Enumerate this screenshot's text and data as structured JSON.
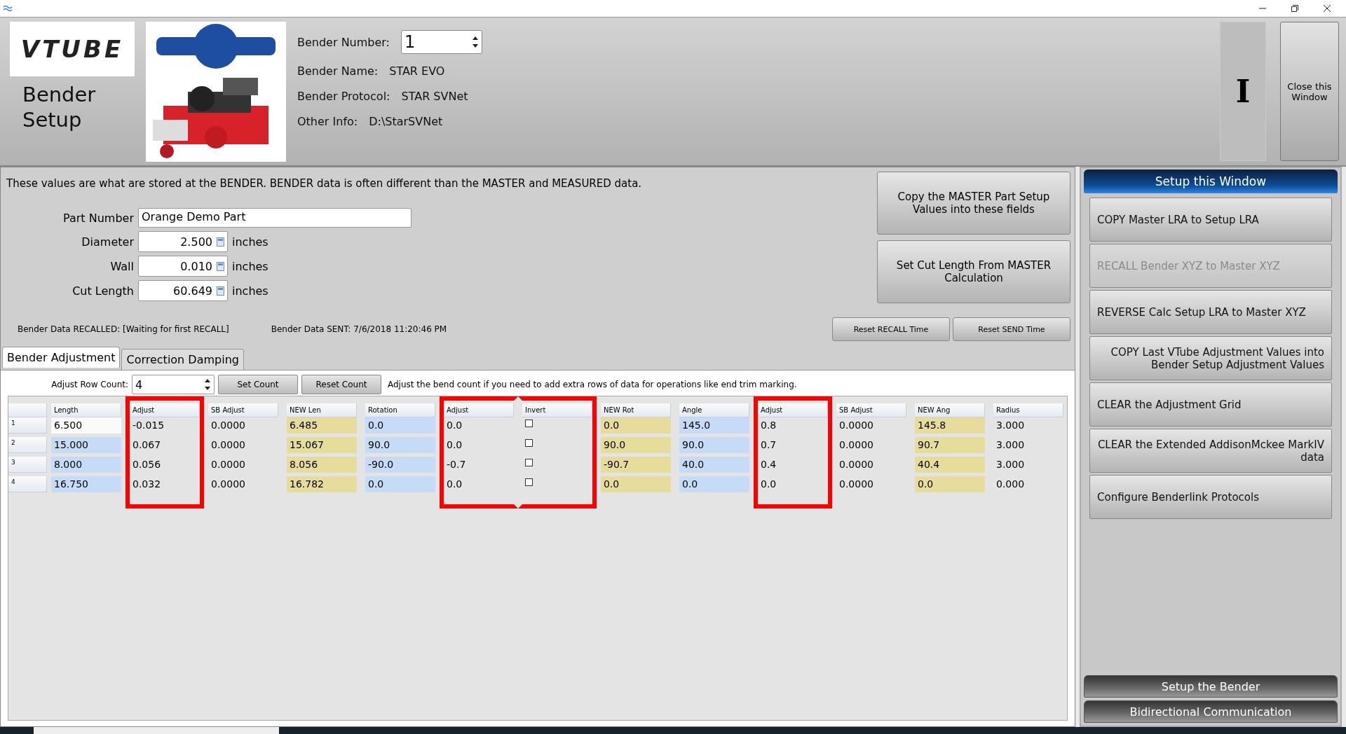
{
  "header": {
    "logo": "VTUBE",
    "title": "Bender Setup",
    "info": [
      {
        "kind": "spinner",
        "label": "Bender Number:",
        "value": "1"
      },
      {
        "kind": "text",
        "label": "Bender Name:",
        "value": "STAR EVO"
      },
      {
        "kind": "text",
        "label": "Bender Protocol:",
        "value": "STAR SVNet"
      },
      {
        "kind": "text",
        "label": "Other Info:",
        "value": "D:\\StarSVNet"
      }
    ],
    "cursor_glyph": "I",
    "close_button": "Close this Window"
  },
  "intro": "These values are what are stored at the BENDER.  BENDER data is often different than the MASTER and MEASURED data.",
  "form": [
    {
      "kind": "text",
      "label": "Part Number",
      "value": "Orange Demo Part"
    },
    {
      "kind": "number",
      "label": "Diameter",
      "value": "2.500",
      "unit": "inches"
    },
    {
      "kind": "number",
      "label": "Wall",
      "value": "0.010",
      "unit": "inches"
    },
    {
      "kind": "number",
      "label": "Cut Length",
      "value": "60.649",
      "unit": "inches"
    }
  ],
  "master_buttons": [
    "Copy the MASTER Part Setup Values into these fields",
    "Set Cut Length From MASTER Calculation"
  ],
  "status": [
    {
      "label": "Bender Data RECALLED:",
      "value": "[Waiting for first RECALL]"
    },
    {
      "label": "Bender Data SENT:",
      "value": "7/6/2018 11:20:46 PM"
    }
  ],
  "reset_buttons": [
    "Reset RECALL Time",
    "Reset SEND Time"
  ],
  "tabs": [
    {
      "label": "Bender Adjustment",
      "selected": true
    },
    {
      "label": "Correction Damping",
      "selected": false
    }
  ],
  "row_count": {
    "label": "Adjust Row Count:",
    "value": "4",
    "buttons": [
      "Set Count",
      "Reset Count"
    ],
    "hint": "Adjust the bend count if you need to add extra rows of data for operations like end trim marking."
  },
  "grid": {
    "columns": [
      {
        "label": "Length",
        "kind": "input",
        "highlighted": false
      },
      {
        "label": "Adjust",
        "kind": "plain",
        "highlighted": true
      },
      {
        "label": "SB Adjust",
        "kind": "plain",
        "highlighted": false
      },
      {
        "label": "NEW Len",
        "kind": "computed",
        "highlighted": false
      },
      {
        "label": "Rotation",
        "kind": "input",
        "highlighted": false
      },
      {
        "label": "Adjust",
        "kind": "plain",
        "highlighted": true
      },
      {
        "label": "Invert",
        "kind": "checkbox",
        "highlighted": true
      },
      {
        "label": "NEW Rot",
        "kind": "computed",
        "highlighted": false
      },
      {
        "label": "Angle",
        "kind": "input",
        "highlighted": false
      },
      {
        "label": "Adjust",
        "kind": "plain",
        "highlighted": true
      },
      {
        "label": "SB Adjust",
        "kind": "plain",
        "highlighted": false
      },
      {
        "label": "NEW Ang",
        "kind": "computed",
        "highlighted": false
      },
      {
        "label": "Radius",
        "kind": "plain",
        "highlighted": false
      }
    ],
    "rows": [
      {
        "number": "1",
        "focused": true,
        "cells": [
          "6.500",
          "-0.015",
          "0.0000",
          "6.485",
          "0.0",
          "0.0",
          false,
          "0.0",
          "145.0",
          "0.8",
          "0.0000",
          "145.8",
          "3.000"
        ]
      },
      {
        "number": "2",
        "focused": false,
        "cells": [
          "15.000",
          "0.067",
          "0.0000",
          "15.067",
          "90.0",
          "0.0",
          false,
          "90.0",
          "90.0",
          "0.7",
          "0.0000",
          "90.7",
          "3.000"
        ]
      },
      {
        "number": "3",
        "focused": false,
        "cells": [
          "8.000",
          "0.056",
          "0.0000",
          "8.056",
          "-90.0",
          "-0.7",
          false,
          "-90.7",
          "40.0",
          "0.4",
          "0.0000",
          "40.4",
          "3.000"
        ]
      },
      {
        "number": "4",
        "focused": false,
        "cells": [
          "16.750",
          "0.032",
          "0.0000",
          "16.782",
          "0.0",
          "0.0",
          false,
          "0.0",
          "0.0",
          "0.0",
          "0.0000",
          "0.0",
          "0.000"
        ]
      }
    ]
  },
  "side_panel": {
    "title": "Setup this Window",
    "buttons": [
      {
        "label": "COPY Master LRA to Setup LRA",
        "disabled": false
      },
      {
        "label": "RECALL Bender XYZ to Master XYZ",
        "disabled": true
      },
      {
        "label": "REVERSE Calc Setup LRA to Master XYZ",
        "disabled": false
      },
      {
        "label": "COPY Last VTube Adjustment Values into Bender Setup Adjustment Values",
        "disabled": false
      },
      {
        "label": "CLEAR the Adjustment Grid",
        "disabled": false
      },
      {
        "label": "CLEAR the Extended AddisonMckee MarkIV data",
        "disabled": false
      },
      {
        "label": "Configure Benderlink Protocols",
        "disabled": false
      }
    ],
    "sections": [
      "Setup the Bender",
      "Bidirectional Communication"
    ]
  }
}
